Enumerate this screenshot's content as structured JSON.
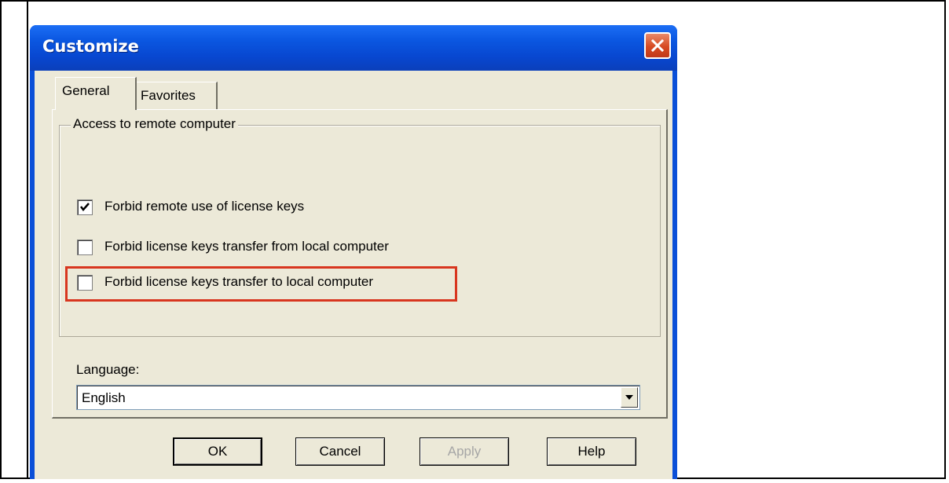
{
  "dialog": {
    "title": "Customize"
  },
  "tabs": [
    {
      "label": "General",
      "active": true
    },
    {
      "label": "Favorites",
      "active": false
    }
  ],
  "group": {
    "legend": "Access to remote computer",
    "checkboxes": [
      {
        "label": "Forbid remote use of license keys",
        "checked": true
      },
      {
        "label": "Forbid license keys transfer from local computer",
        "checked": false
      },
      {
        "label": "Forbid license keys transfer to local computer",
        "checked": false,
        "highlighted": true
      }
    ]
  },
  "language": {
    "label": "Language:",
    "value": "English"
  },
  "buttons": {
    "ok": "OK",
    "cancel": "Cancel",
    "apply": "Apply",
    "help": "Help"
  },
  "colors": {
    "highlight": "#d8361f",
    "titlebar": "#0a56e0",
    "face": "#ece9d8"
  },
  "icons": {
    "close": "close-icon",
    "checkmark": "checkmark-icon",
    "dropdown": "chevron-down-icon"
  }
}
